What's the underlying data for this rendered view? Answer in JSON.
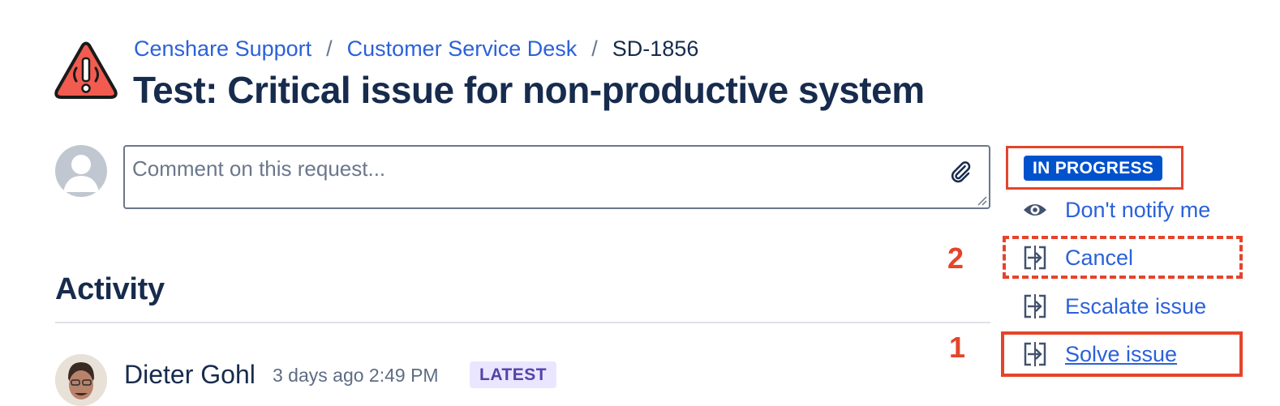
{
  "breadcrumb": {
    "project": "Censhare Support",
    "desk": "Customer Service Desk",
    "issue_key": "SD-1856",
    "separator": "/"
  },
  "issue": {
    "title": "Test: Critical issue for non-productive system",
    "priority_icon": "warning-triangle-icon"
  },
  "comment": {
    "placeholder": "Comment on this request...",
    "attach_icon": "paperclip-icon"
  },
  "activity": {
    "heading": "Activity",
    "entries": [
      {
        "author": "Dieter Gohl",
        "time": "3 days ago 2:49 PM",
        "badge": "LATEST"
      }
    ]
  },
  "sidebar": {
    "status": "IN PROGRESS",
    "actions": [
      {
        "label": "Don't notify me",
        "icon": "eye-icon"
      },
      {
        "label": "Cancel",
        "icon": "transition-icon"
      },
      {
        "label": "Escalate issue",
        "icon": "transition-icon"
      },
      {
        "label": "Solve issue",
        "icon": "transition-icon"
      }
    ]
  },
  "annotations": {
    "marker_1": "1",
    "marker_2": "2"
  },
  "colors": {
    "link": "#2b61d9",
    "text": "#172b4d",
    "status_badge": "#0052cc",
    "annotation": "#e5442b",
    "latest_badge_bg": "#eae6ff"
  }
}
